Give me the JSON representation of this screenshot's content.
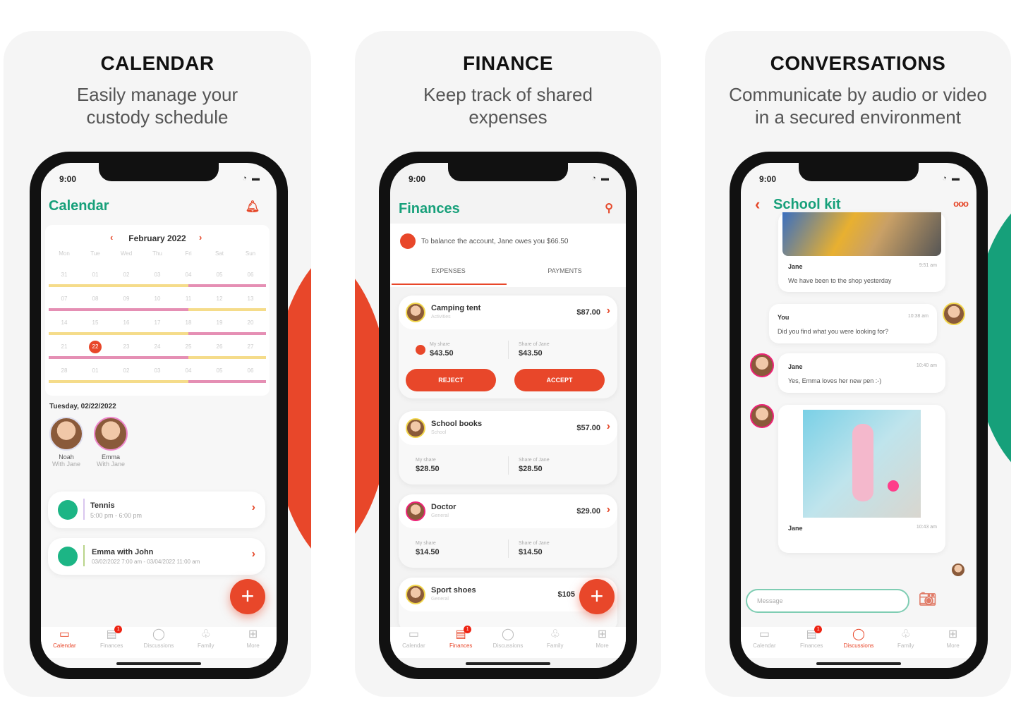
{
  "colors": {
    "accent": "#e8472a",
    "green": "#17a07a",
    "yellow": "#f5dc8a",
    "pink": "#e58fb4"
  },
  "status_time": "9:00",
  "panels": [
    {
      "heading": "CALENDAR",
      "subtitle": [
        "Easily manage your",
        "custody schedule"
      ]
    },
    {
      "heading": "FINANCE",
      "subtitle": [
        "Keep track of shared",
        "expenses"
      ]
    },
    {
      "heading": "CONVERSATIONS",
      "subtitle": [
        "Communicate by audio or video",
        "in a secured environment"
      ]
    }
  ],
  "tabs": [
    "Calendar",
    "Finances",
    "Discussions",
    "Family",
    "More"
  ],
  "tab_badge": "1",
  "calendar": {
    "title": "Calendar",
    "month": "February 2022",
    "weekdays": [
      "Mon",
      "Tue",
      "Wed",
      "Thu",
      "Fri",
      "Sat",
      "Sun"
    ],
    "weeks": [
      [
        "31",
        "01",
        "02",
        "03",
        "04",
        "05",
        "06"
      ],
      [
        "07",
        "08",
        "09",
        "10",
        "11",
        "12",
        "13"
      ],
      [
        "14",
        "15",
        "16",
        "17",
        "18",
        "19",
        "20"
      ],
      [
        "21",
        "22",
        "23",
        "24",
        "25",
        "26",
        "27"
      ],
      [
        "28",
        "01",
        "02",
        "03",
        "04",
        "05",
        "06"
      ]
    ],
    "selected_day": "22",
    "date_label": "Tuesday, 02/22/2022",
    "children": [
      {
        "name": "Noah",
        "sub": "With Jane"
      },
      {
        "name": "Emma",
        "sub": "With Jane"
      }
    ],
    "events": [
      {
        "title": "Tennis",
        "time": "5:00 pm - 6:00 pm"
      },
      {
        "title": "Emma with John",
        "time": "03/02/2022 7:00 am - 03/04/2022 11:00 am"
      }
    ]
  },
  "finances": {
    "title": "Finances",
    "balance": "To balance the account, Jane owes you $66.50",
    "tabs": [
      "EXPENSES",
      "PAYMENTS"
    ],
    "expenses": [
      {
        "title": "Camping tent",
        "category": "Activities",
        "amount": "$87.00",
        "my_share_label": "My share",
        "my_share": "$43.50",
        "other_label": "Share of Jane",
        "other_share": "$43.50",
        "reject": "REJECT",
        "accept": "ACCEPT"
      },
      {
        "title": "School books",
        "category": "School",
        "amount": "$57.00",
        "my_share_label": "My share",
        "my_share": "$28.50",
        "other_label": "Share of Jane",
        "other_share": "$28.50"
      },
      {
        "title": "Doctor",
        "category": "General",
        "amount": "$29.00",
        "my_share_label": "My share",
        "my_share": "$14.50",
        "other_label": "Share of Jane",
        "other_share": "$14.50"
      },
      {
        "title": "Sport shoes",
        "category": "General",
        "amount": "$105"
      }
    ]
  },
  "chat": {
    "title": "School kit",
    "messages": [
      {
        "sender": "Jane",
        "time": "9:51 am",
        "text": "We have been to the shop yesterday"
      },
      {
        "sender": "You",
        "time": "10:38 am",
        "text": "Did you find what you were looking for?"
      },
      {
        "sender": "Jane",
        "time": "10:40 am",
        "text": "Yes, Emma loves her new pen :-)"
      },
      {
        "sender": "Jane",
        "time": "10:43 am",
        "text": ""
      }
    ],
    "placeholder": "Message"
  }
}
